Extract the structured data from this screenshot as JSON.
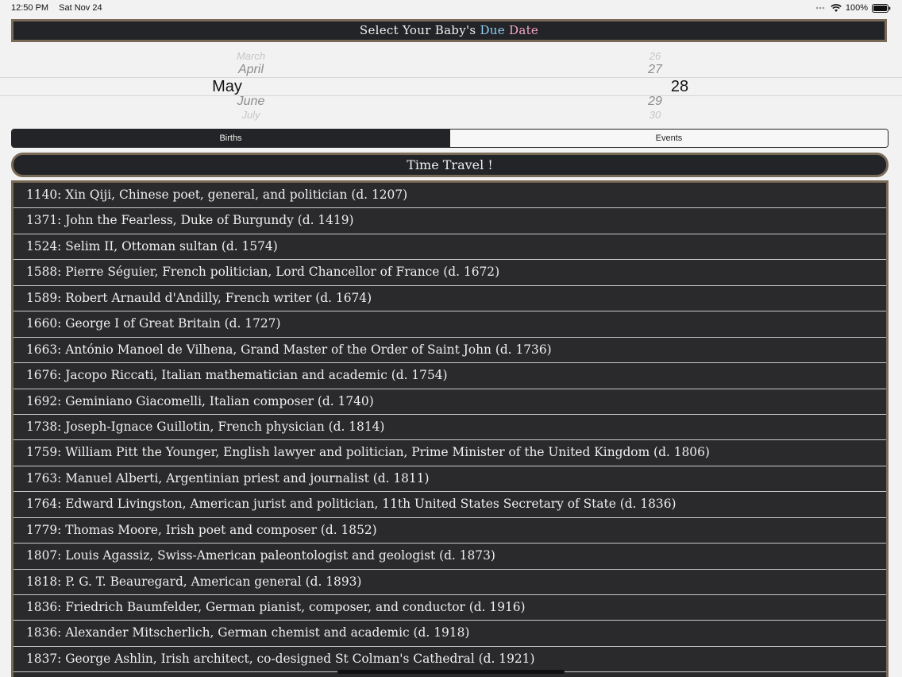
{
  "status_bar": {
    "time": "12:50 PM",
    "date": "Sat Nov 24",
    "battery": "100%"
  },
  "header": {
    "title_prefix": "Select Your Baby's",
    "title_due": "Due",
    "title_date": "Date",
    "due_color": "#8fd0f5",
    "date_color": "#f3a6c6"
  },
  "picker": {
    "months": [
      "March",
      "April",
      "May",
      "June",
      "July"
    ],
    "days": [
      "26",
      "27",
      "28",
      "29",
      "30"
    ],
    "selected_month": "May",
    "selected_day": "28"
  },
  "segments": [
    "Births",
    "Events"
  ],
  "selected_segment": "Births",
  "time_travel_label": "Time Travel !",
  "births": [
    "1140: Xin Qiji, Chinese poet, general, and politician (d. 1207)",
    "1371: John the Fearless, Duke of Burgundy (d. 1419)",
    "1524: Selim II, Ottoman sultan (d. 1574)",
    "1588: Pierre Séguier, French politician, Lord Chancellor of France (d. 1672)",
    "1589: Robert Arnauld d'Andilly, French writer (d. 1674)",
    "1660: George I of Great Britain (d. 1727)",
    "1663: António Manoel de Vilhena, Grand Master of the Order of Saint John (d. 1736)",
    "1676: Jacopo Riccati, Italian mathematician and academic (d. 1754)",
    "1692: Geminiano Giacomelli, Italian composer (d. 1740)",
    "1738: Joseph-Ignace Guillotin, French physician (d. 1814)",
    "1759: William Pitt the Younger, English lawyer and politician, Prime Minister of the United Kingdom (d. 1806)",
    "1763: Manuel Alberti, Argentinian priest and journalist (d. 1811)",
    "1764: Edward Livingston, American jurist and politician, 11th United States Secretary of State (d. 1836)",
    "1779: Thomas Moore, Irish poet and composer (d. 1852)",
    "1807: Louis Agassiz, Swiss-American paleontologist and geologist (d. 1873)",
    "1818: P. G. T. Beauregard, American general (d. 1893)",
    "1836: Friedrich Baumfelder, German pianist, composer, and conductor (d. 1916)",
    "1836: Alexander Mitscherlich, German chemist and academic (d. 1918)",
    "1837: George Ashlin, Irish architect, co-designed St Colman's Cathedral (d. 1921)"
  ]
}
